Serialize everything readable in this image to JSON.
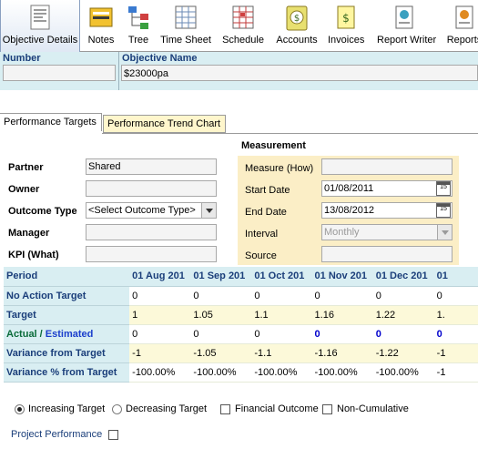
{
  "toolbar": {
    "items": [
      {
        "label": "Objective Details",
        "icon": "document-icon"
      },
      {
        "label": "Notes",
        "icon": "notes-icon"
      },
      {
        "label": "Tree",
        "icon": "tree-icon"
      },
      {
        "label": "Time Sheet",
        "icon": "timesheet-icon"
      },
      {
        "label": "Schedule",
        "icon": "schedule-icon"
      },
      {
        "label": "Accounts",
        "icon": "accounts-icon"
      },
      {
        "label": "Invoices",
        "icon": "invoices-icon"
      },
      {
        "label": "Report Writer",
        "icon": "report-writer-icon"
      },
      {
        "label": "Reports",
        "icon": "reports-icon"
      }
    ]
  },
  "header": {
    "number_label": "Number",
    "number_value": "",
    "objective_label": "Objective Name",
    "objective_value": "$23000pa"
  },
  "tabs": [
    "Performance Targets",
    "Performance Trend Chart"
  ],
  "form": {
    "partner_label": "Partner",
    "partner_value": "Shared",
    "owner_label": "Owner",
    "owner_value": "",
    "outcome_label": "Outcome Type",
    "outcome_value": "<Select Outcome Type>",
    "manager_label": "Manager",
    "manager_value": "",
    "kpi_label": "KPI (What)",
    "kpi_value": ""
  },
  "measurement": {
    "title": "Measurement",
    "measure_label": "Measure (How)",
    "measure_value": "",
    "start_label": "Start Date",
    "start_value": "01/08/2011",
    "end_label": "End Date",
    "end_value": "13/08/2012",
    "interval_label": "Interval",
    "interval_value": "Monthly",
    "source_label": "Source",
    "source_value": "",
    "calendar_glyph": "15"
  },
  "grid": {
    "period_label": "Period",
    "columns": [
      "01 Aug 201",
      "01 Sep 201",
      "01 Oct 201",
      "01 Nov 201",
      "01 Dec 201",
      "01"
    ],
    "rows": [
      {
        "label": "No Action Target",
        "values": [
          "0",
          "0",
          "0",
          "0",
          "0",
          "0"
        ]
      },
      {
        "label": "Target",
        "values": [
          "1",
          "1.05",
          "1.1",
          "1.16",
          "1.22",
          "1."
        ]
      },
      {
        "label_a": "Actual / ",
        "label_b": "Estimated",
        "values": [
          "0",
          "0",
          "0",
          "0",
          "0",
          "0"
        ]
      },
      {
        "label": "Variance from Target",
        "values": [
          "-1",
          "-1.05",
          "-1.1",
          "-1.16",
          "-1.22",
          "-1"
        ]
      },
      {
        "label": "Variance % from Target",
        "values": [
          "-100.00%",
          "-100.00%",
          "-100.00%",
          "-100.00%",
          "-100.00%",
          "-1"
        ]
      }
    ]
  },
  "options": {
    "increasing": "Increasing Target",
    "decreasing": "Decreasing Target",
    "financial": "Financial Outcome",
    "noncumulative": "Non-Cumulative",
    "project": "Project Performance"
  }
}
